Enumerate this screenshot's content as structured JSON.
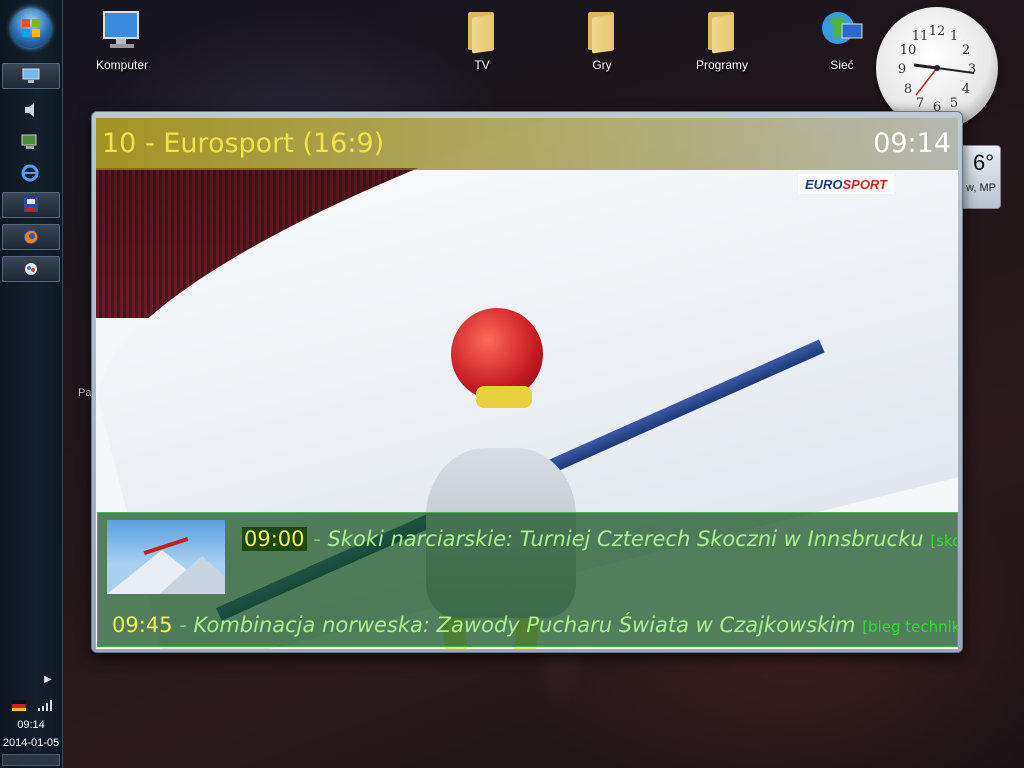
{
  "desktop": {
    "icons": [
      {
        "label": "Komputer",
        "kind": "computer"
      },
      {
        "label": "TV",
        "kind": "folder"
      },
      {
        "label": "Gry",
        "kind": "folder"
      },
      {
        "label": "Programy",
        "kind": "folder"
      },
      {
        "label": "Sieć",
        "kind": "network"
      }
    ],
    "peek_text": "Pa"
  },
  "taskbar": {
    "buttons": [
      "display-settings-icon",
      "volume-icon",
      "network-monitor-icon",
      "internet-explorer-icon",
      "save-disk-icon",
      "firefox-icon",
      "media-center-icon"
    ],
    "clock": {
      "time": "09:14",
      "date": "2014-01-05"
    }
  },
  "gadgets": {
    "clock": {
      "hour": 9,
      "minute": 14
    },
    "weather": {
      "temperature": "6°",
      "location": "w, MP"
    }
  },
  "player": {
    "channel_title": "10 - Eurosport (16:9)",
    "time": "09:14",
    "broadcaster_logo": {
      "euro": "EURO",
      "sport": "SPORT"
    },
    "epg": [
      {
        "time": "09:00",
        "title": "Skoki narciarskie: Turniej Czterech Skoczni w Innsbrucku",
        "category": "[skoki",
        "current": true
      },
      {
        "time": "09:45",
        "title": "Kombinacja norweska: Zawody Pucharu Świata w Czajkowskim",
        "category": "[bieg technik",
        "current": false
      }
    ],
    "separator": " - "
  },
  "colors": {
    "channel_title": "#f4e04a",
    "epg_time": "#f4f050",
    "epg_program": "#a8f08a",
    "epg_category": "#2ee02a",
    "epg_border": "#46b04a"
  }
}
